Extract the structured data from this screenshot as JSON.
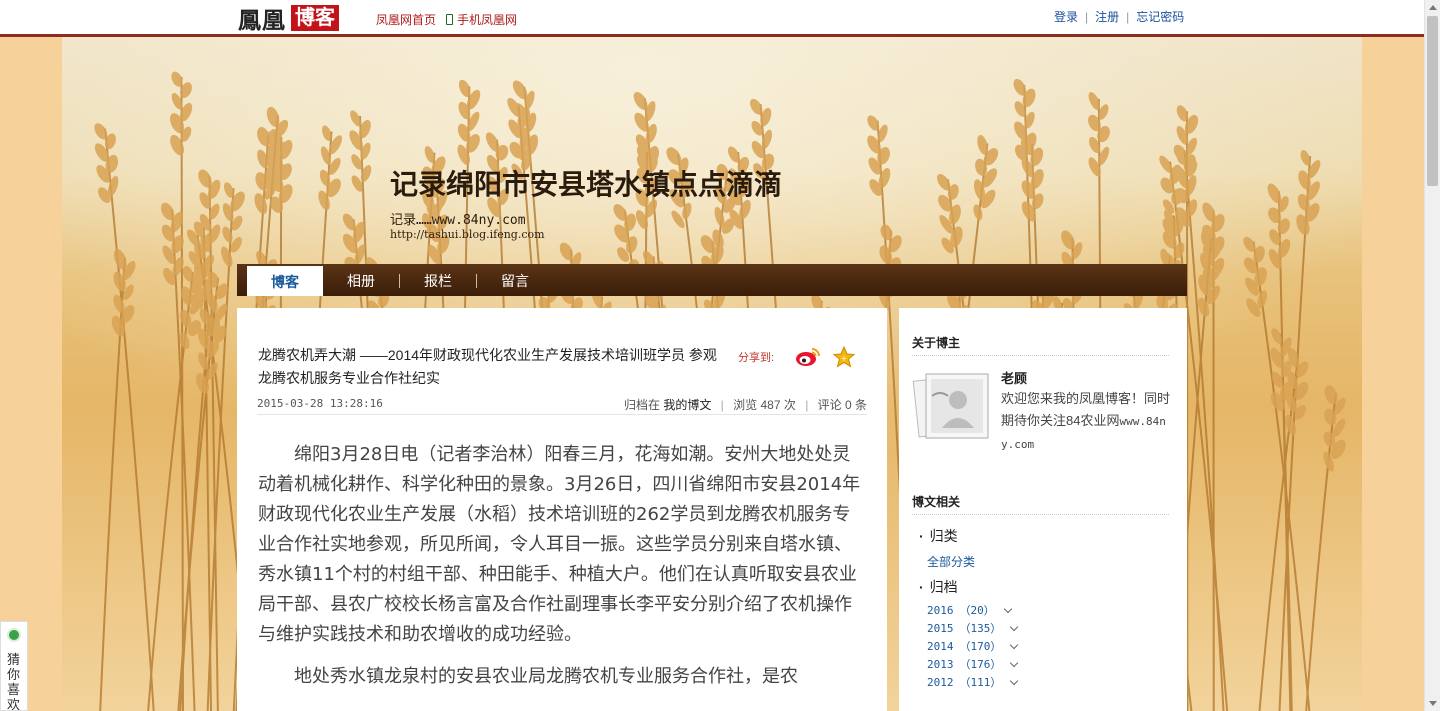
{
  "header": {
    "logo_main": "鳳凰",
    "logo_box": "博客",
    "links": [
      "凤凰网首页",
      "手机凤凰网"
    ],
    "account": [
      "登录",
      "注册",
      "忘记密码"
    ]
  },
  "blog": {
    "title": "记录绵阳市安县塔水镇点点滴滴",
    "desc": "记录……www.84ny.com",
    "url": "http://tashui.blog.ifeng.com"
  },
  "nav": {
    "items": [
      "博客",
      "相册",
      "报栏",
      "留言"
    ],
    "active": "博客"
  },
  "article": {
    "title": "龙腾农机弄大潮 ——2014年财政现代化农业生产发展技术培训班学员 参观龙腾农机服务专业合作社纪实",
    "share_label": "分享到:",
    "date": "2015-03-28 13:28:16",
    "filed_label": "归档在",
    "category": "我的博文",
    "views": "浏览 487 次",
    "comments": "评论 0 条",
    "paragraphs": [
      "绵阳3月28日电（记者李治林）阳春三月，花海如潮。安州大地处处灵动着机械化耕作、科学化种田的景象。3月26日，四川省绵阳市安县2014年财政现代化农业生产发展（水稻）技术培训班的262学员到龙腾农机服务专业合作社实地参观，所见所闻，令人耳目一振。这些学员分别来自塔水镇、秀水镇11个村的村组干部、种田能手、种植大户。他们在认真听取安县农业局干部、县农广校校长杨言富及合作社副理事长李平安分别介绍了农机操作与维护实践技术和助农增收的成功经验。",
      "地处秀水镇龙泉村的安县农业局龙腾农机专业服务合作社，是农"
    ]
  },
  "sidebar": {
    "about_title": "关于博主",
    "author_name": "老顾",
    "author_intro": "欢迎您来我的凤凰博客！同时期待你关注84农业网",
    "author_intro_url": "www.84ny.com",
    "related_title": "博文相关",
    "category_head": "归类",
    "all_categories": "全部分类",
    "archive_head": "归档",
    "archive": [
      {
        "year": "2016",
        "count": "（20）"
      },
      {
        "year": "2015",
        "count": "（135）"
      },
      {
        "year": "2014",
        "count": "（170）"
      },
      {
        "year": "2013",
        "count": "（176）"
      },
      {
        "year": "2012",
        "count": "（111）"
      }
    ]
  },
  "widget": {
    "label": "猜你喜欢"
  },
  "colors": {
    "topbar_line": "#8b2e1e",
    "logo_red": "#c4121a",
    "link_blue": "#1a5a9c",
    "nav_brown": "#3b1d08",
    "page_bg": "#f6d29a"
  },
  "icons": [
    "phone-icon",
    "weibo-icon",
    "favorite-star-icon",
    "avatar-placeholder-icon",
    "chevron-down-icon",
    "status-dot-icon"
  ]
}
